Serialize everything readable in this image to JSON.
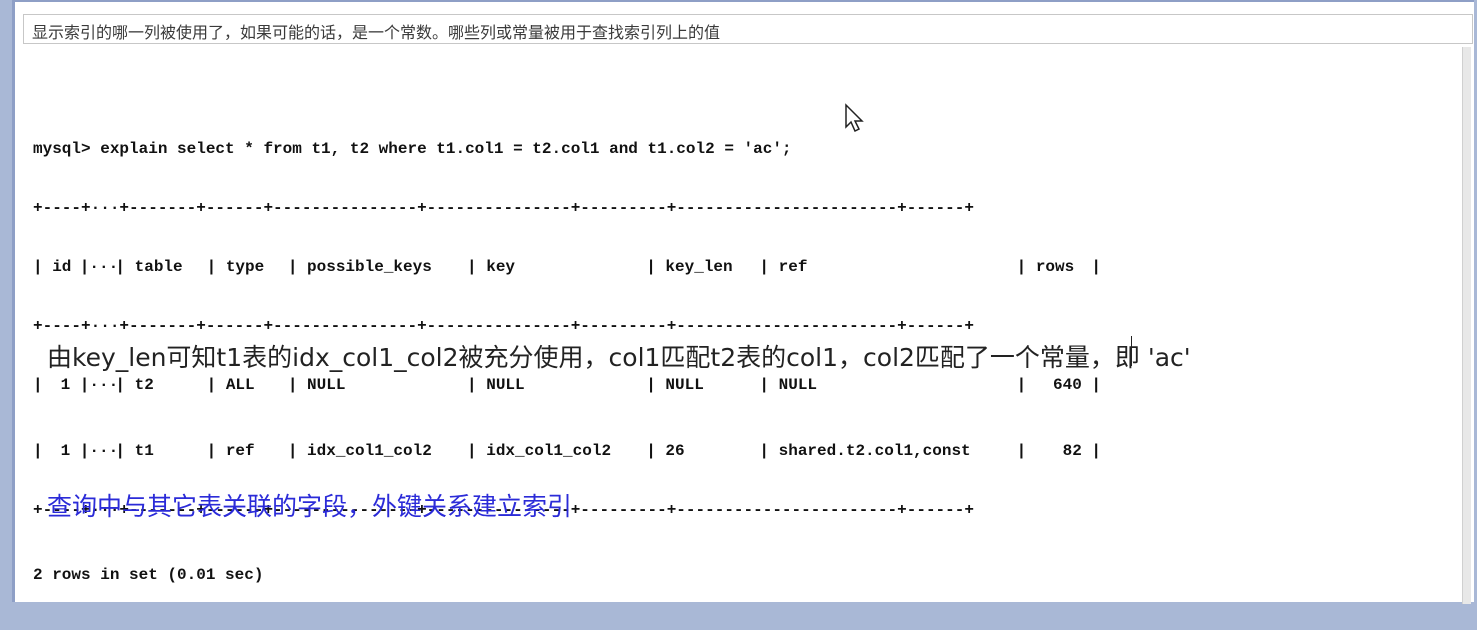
{
  "header": {
    "text": "显示索引的哪一列被使用了，如果可能的话，是一个常数。哪些列或常量被用于查找索引列上的值"
  },
  "terminal": {
    "command": "mysql> explain select * from t1, t2 where t1.col1 = t2.col1 and t1.col2 = 'ac';",
    "border": "+----+···+-------+------+---------------+---------------+---------+-----------------------+------+",
    "columns": [
      "id",
      "···",
      "table",
      "type",
      "possible_keys",
      "key",
      "key_len",
      "ref",
      "rows"
    ],
    "rows": [
      [
        "1",
        "···",
        "t2",
        "ALL",
        "NULL",
        "NULL",
        "NULL",
        "NULL",
        "640"
      ],
      [
        "1",
        "···",
        "t1",
        "ref",
        "idx_col1_col2",
        "idx_col1_col2",
        "26",
        "shared.t2.col1,const",
        "82"
      ]
    ],
    "summary": "2 rows in set (0.01 sec)"
  },
  "notes": {
    "explanation": "由key_len可知t1表的idx_col1_col2被充分使用，col1匹配t2表的col1，col2匹配了一个常量，即 'ac'",
    "blue": "查询中与其它表关联的字段，外键关系建立索引"
  },
  "colors": {
    "blue_text": "#2b2bd8",
    "frame": "#8e9fc6"
  },
  "icons": {
    "cursor": "mouse-pointer-icon"
  }
}
